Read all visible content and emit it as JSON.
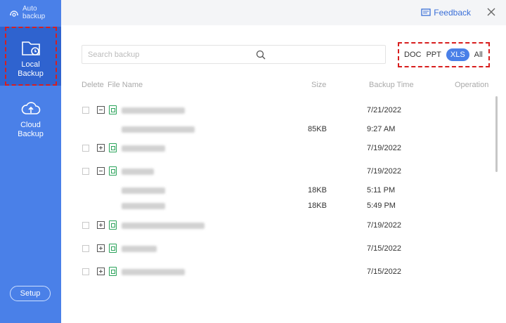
{
  "sidebar": {
    "auto_backup": "Auto\nbackup",
    "local_backup": "Local\nBackup",
    "cloud_backup": "Cloud\nBackup",
    "setup": "Setup"
  },
  "topbar": {
    "feedback": "Feedback"
  },
  "search": {
    "placeholder": "Search backup"
  },
  "filter": {
    "options": [
      "DOC",
      "PPT",
      "XLS",
      "All"
    ],
    "selected": "XLS"
  },
  "columns": {
    "delete": "Delete",
    "file_name": "File Name",
    "size": "Size",
    "backup_time": "Backup Time",
    "operation": "Operation"
  },
  "rows": [
    {
      "type": "group",
      "expanded": true,
      "date": "7/21/2022"
    },
    {
      "type": "child",
      "size": "85KB",
      "time": "9:27 AM"
    },
    {
      "type": "group",
      "expanded": false,
      "date": "7/19/2022"
    },
    {
      "type": "group",
      "expanded": true,
      "date": "7/19/2022"
    },
    {
      "type": "child",
      "size": "18KB",
      "time": "5:11 PM"
    },
    {
      "type": "child",
      "size": "18KB",
      "time": "5:49 PM"
    },
    {
      "type": "group",
      "expanded": false,
      "date": "7/19/2022"
    },
    {
      "type": "group",
      "expanded": false,
      "date": "7/15/2022"
    },
    {
      "type": "group",
      "expanded": false,
      "date": "7/15/2022"
    }
  ],
  "colors": {
    "sidebar": "#4a80e8",
    "sidebar_active": "#2f63cf",
    "accent": "#4a80e8",
    "highlight": "#d81e1e",
    "xls_icon": "#2aa35a"
  }
}
